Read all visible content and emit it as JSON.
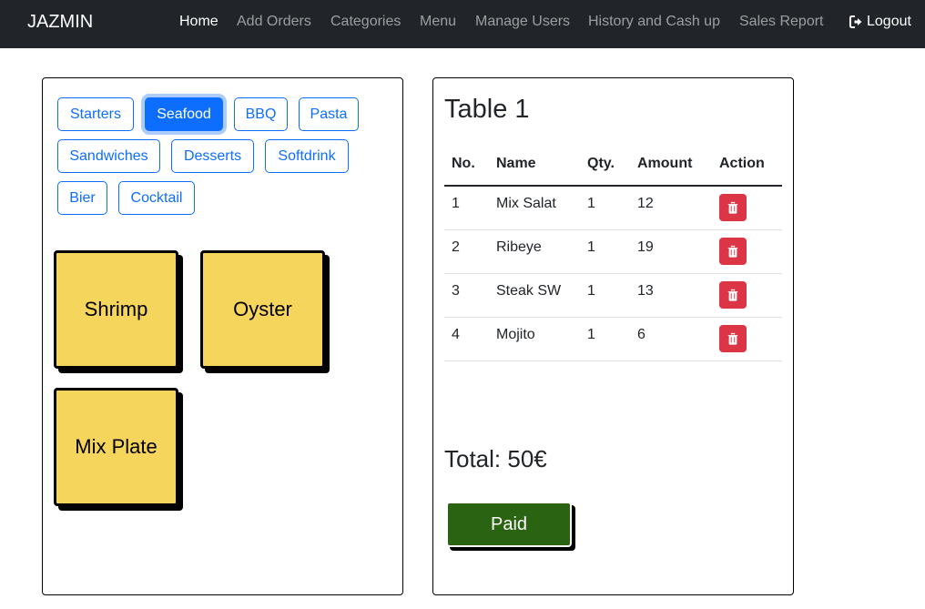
{
  "navbar": {
    "brand": "JAZMIN",
    "links": [
      "Home",
      "Add Orders",
      "Categories",
      "Menu",
      "Manage Users",
      "History and Cash up",
      "Sales Report"
    ],
    "active": "Home",
    "logout": "Logout"
  },
  "categories": [
    "Starters",
    "Seafood",
    "BBQ",
    "Pasta",
    "Sandwiches",
    "Desserts",
    "Softdrink",
    "Bier",
    "Cocktail"
  ],
  "selected_category": "Seafood",
  "menu_items": [
    "Shrimp",
    "Oyster",
    "Mix Plate"
  ],
  "order": {
    "title": "Table 1",
    "headers": [
      "No.",
      "Name",
      "Qty.",
      "Amount",
      "Action"
    ],
    "rows": [
      {
        "no": "1",
        "name": "Mix Salat",
        "qty": "1",
        "amount": "12"
      },
      {
        "no": "2",
        "name": "Ribeye",
        "qty": "1",
        "amount": "19"
      },
      {
        "no": "3",
        "name": "Steak SW",
        "qty": "1",
        "amount": "13"
      },
      {
        "no": "4",
        "name": "Mojito",
        "qty": "1",
        "amount": "6"
      }
    ],
    "total": "Total: 50€",
    "paid_label": "Paid"
  },
  "colors": {
    "navbar": "#212529",
    "primary": "#0d6efd",
    "item_card": "#f6d55c",
    "delete": "#dc3545",
    "paid": "#2a6412"
  },
  "icons": {
    "logout": "logout-icon",
    "delete": "trash-icon"
  }
}
